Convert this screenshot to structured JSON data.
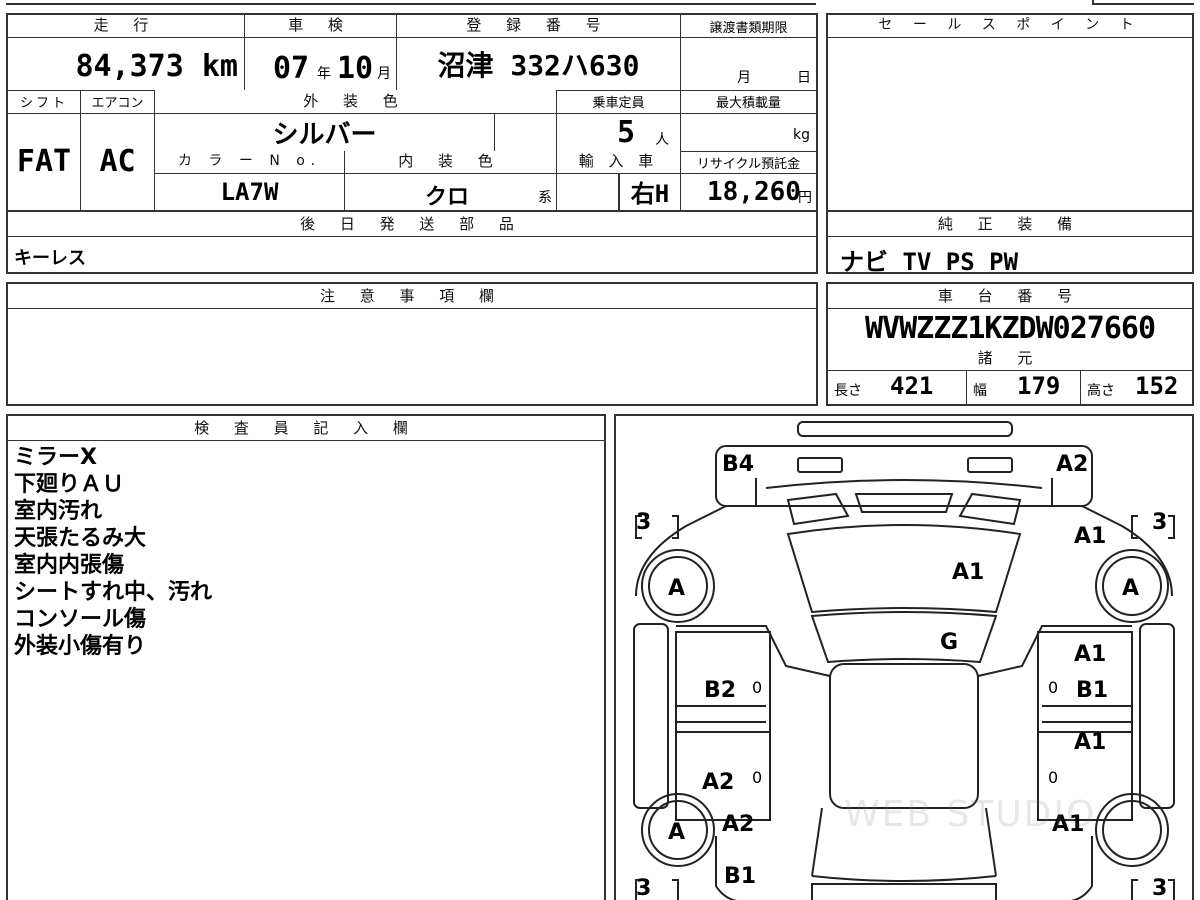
{
  "top": {
    "mileage_h": "走 行",
    "mileage": "84,373 km",
    "shaken_h": "車 検",
    "shaken_year": "07",
    "shaken_year_unit": "年",
    "shaken_month": "10",
    "shaken_month_unit": "月",
    "reg_h": "登 録 番 号",
    "reg": "沼津 332ハ630",
    "transfer_h": "譲渡書類期限",
    "transfer_month": "月",
    "transfer_day": "日"
  },
  "row2": {
    "shift_h": "シフト",
    "shift": "FAT",
    "ac_h": "エアコン",
    "ac": "AC",
    "ext_color_h": "外 装 色",
    "ext_color": "シルバー",
    "capacity_h": "乗車定員",
    "capacity": "5",
    "capacity_unit": "人",
    "maxload_h": "最大積載量",
    "maxload_unit": "kg",
    "color_no_h": "カ ラ ー N o.",
    "color_no": "LA7W",
    "int_color_h": "内 装 色",
    "int_color": "クロ",
    "int_color_unit": "系",
    "import_h": "輸 入 車",
    "import": "右H",
    "recycle_h": "リサイクル預託金",
    "recycle": "18,260",
    "recycle_unit": "円"
  },
  "later_parts": {
    "header": "後 日 発 送 部 品",
    "value": "キーレス"
  },
  "sales_point": {
    "header": "セ ー ル ス ポ イ ン ト"
  },
  "equipment": {
    "header": "純 正 装 備",
    "value": "ナビ TV PS PW"
  },
  "notes": {
    "header": "注 意 事 項 欄"
  },
  "chassis": {
    "header": "車 台 番 号",
    "value": "WVWZZZ1KZDW027660"
  },
  "specs": {
    "header": "諸 元",
    "length_label": "長さ",
    "length": "421",
    "width_label": "幅",
    "width": "179",
    "height_label": "高さ",
    "height": "152"
  },
  "inspector": {
    "header": "検 査 員 記 入 欄",
    "lines": [
      "ミラーX",
      "下廻りＡＵ",
      "室内汚れ",
      "天張たるみ大",
      "室内内張傷",
      "シートすれ中、汚れ",
      "コンソール傷",
      "外装小傷有り"
    ]
  },
  "diagram": {
    "b4": "B4",
    "a2_top": "A2",
    "tire_tl": "3",
    "tire_tr": "3",
    "a1_right": "A1",
    "wheel_l_front": "A",
    "wheel_r_front": "A",
    "a1_hood": "A1",
    "g_windshield": "G",
    "a1_rdoor_front": "A1",
    "b2_ldoor_front": "B2",
    "b1_rdoor_front": "B1",
    "zero1": "0",
    "zero2": "0",
    "zero3": "0",
    "zero4": "0",
    "a1_rdoor_rear": "A1",
    "a2_ldoor_rear": "A2",
    "wheel_l_rear": "A",
    "a2_rear_fender": "A2",
    "a1_rear_fender": "A1",
    "b1_bottom": "B1",
    "tire_bl": "3",
    "tire_br": "3",
    "watermark": "WEB STUDIO"
  }
}
